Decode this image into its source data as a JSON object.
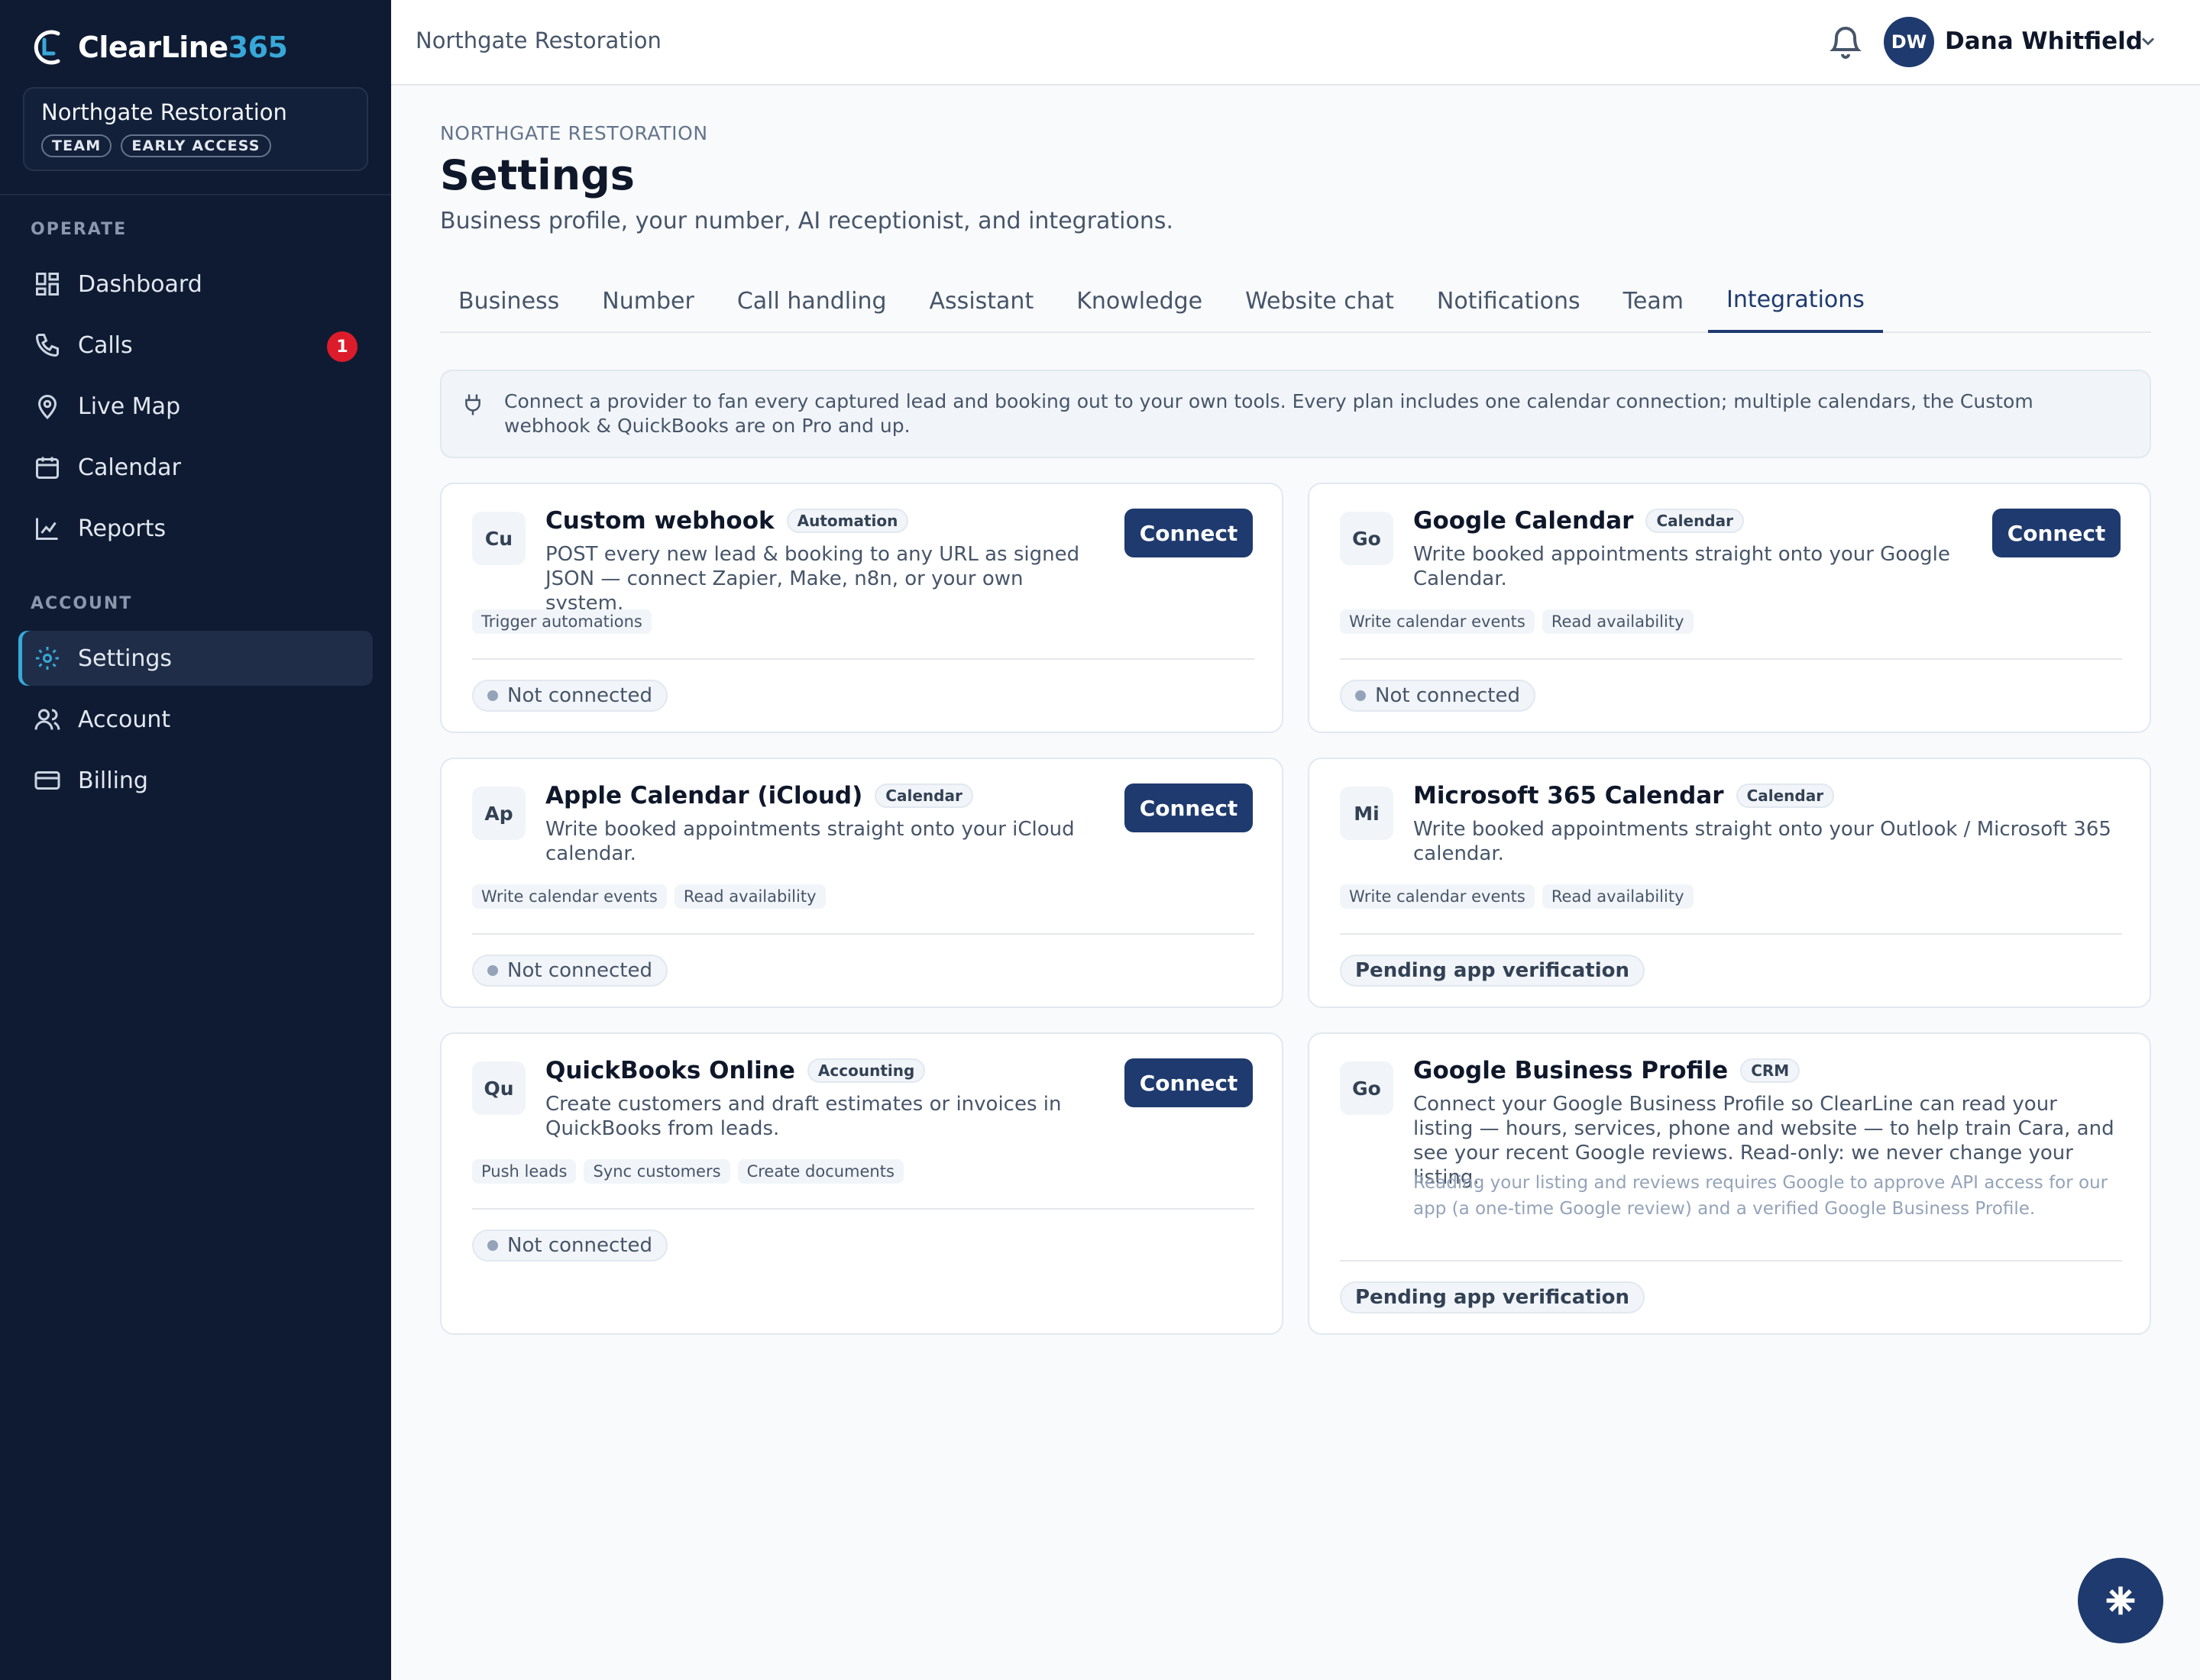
{
  "brand": {
    "name_main": "ClearLine",
    "name_accent": "365"
  },
  "org": {
    "name": "Northgate Restoration",
    "badges": [
      "TEAM",
      "EARLY ACCESS"
    ]
  },
  "sidebar": {
    "sections": [
      {
        "label": "OPERATE"
      },
      {
        "label": "ACCOUNT"
      }
    ],
    "items": [
      {
        "label": "Dashboard",
        "icon": "grid-icon"
      },
      {
        "label": "Calls",
        "icon": "phone-icon",
        "badge": "1"
      },
      {
        "label": "Live Map",
        "icon": "map-pin-icon"
      },
      {
        "label": "Calendar",
        "icon": "calendar-icon"
      },
      {
        "label": "Reports",
        "icon": "chart-icon"
      },
      {
        "label": "Settings",
        "icon": "gear-icon",
        "active": true
      },
      {
        "label": "Account",
        "icon": "users-icon"
      },
      {
        "label": "Billing",
        "icon": "credit-card-icon"
      }
    ]
  },
  "topbar": {
    "breadcrumb": "Northgate Restoration",
    "user": {
      "initials": "DW",
      "name": "Dana Whitfield"
    }
  },
  "page": {
    "eyebrow": "NORTHGATE RESTORATION",
    "title": "Settings",
    "subtitle": "Business profile, your number, AI receptionist, and integrations."
  },
  "tabs": [
    "Business",
    "Number",
    "Call handling",
    "Assistant",
    "Knowledge",
    "Website chat",
    "Notifications",
    "Team",
    "Integrations"
  ],
  "active_tab": "Integrations",
  "info_text": "Connect a provider to fan every captured lead and booking out to your own tools. Every plan includes one calendar connection; multiple calendars, the Custom webhook & QuickBooks are on Pro and up.",
  "integrations": [
    {
      "logo": "Cu",
      "title": "Custom webhook",
      "tag": "Automation",
      "desc": "POST every new lead & booking to any URL as signed JSON — connect Zapier, Make, n8n, or your own system.",
      "chips": [
        "Trigger automations"
      ],
      "button": "Connect",
      "status": "Not connected"
    },
    {
      "logo": "Go",
      "title": "Google Calendar",
      "tag": "Calendar",
      "desc": "Write booked appointments straight onto your Google Calendar.",
      "chips": [
        "Write calendar events",
        "Read availability"
      ],
      "button": "Connect",
      "status": "Not connected"
    },
    {
      "logo": "Ap",
      "title": "Apple Calendar (iCloud)",
      "tag": "Calendar",
      "desc": "Write booked appointments straight onto your iCloud calendar.",
      "chips": [
        "Write calendar events",
        "Read availability"
      ],
      "button": "Connect",
      "status": "Not connected"
    },
    {
      "logo": "Mi",
      "title": "Microsoft 365 Calendar",
      "tag": "Calendar",
      "desc": "Write booked appointments straight onto your Outlook / Microsoft 365 calendar.",
      "chips": [
        "Write calendar events",
        "Read availability"
      ],
      "status": "Pending app verification"
    },
    {
      "logo": "Qu",
      "title": "QuickBooks Online",
      "tag": "Accounting",
      "desc": "Create customers and draft estimates or invoices in QuickBooks from leads.",
      "chips": [
        "Push leads",
        "Sync customers",
        "Create documents"
      ],
      "button": "Connect",
      "status": "Not connected"
    },
    {
      "logo": "Go",
      "title": "Google Business Profile",
      "tag": "CRM",
      "desc": "Connect your Google Business Profile so ClearLine can read your listing — hours, services, phone and website — to help train Cara, and see your recent Google reviews. Read-only: we never change your listing.",
      "note": "Reading your listing and reviews requires Google to approve API access for our app (a one-time Google review) and a verified Google Business Profile.",
      "status": "Pending app verification"
    }
  ],
  "colors": {
    "sidebar": "#0f1b33",
    "primary": "#1e3a6e",
    "accent": "#38a8d8",
    "badge": "#dc1c2a"
  }
}
